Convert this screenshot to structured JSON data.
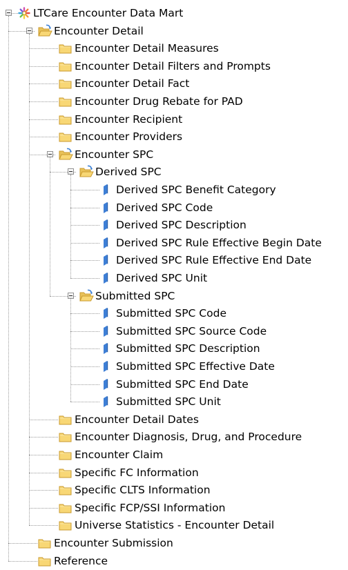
{
  "tree": {
    "root": {
      "label": "LTCare Encounter Data Mart",
      "icon": "universe-icon",
      "expanded": true,
      "children": [
        {
          "label": "Encounter Detail",
          "icon": "folder-open-icon",
          "expanded": true,
          "children": [
            {
              "label": "Encounter Detail Measures",
              "icon": "folder-icon",
              "expanded": false
            },
            {
              "label": "Encounter Detail Filters and Prompts",
              "icon": "folder-icon",
              "expanded": false
            },
            {
              "label": "Encounter Detail Fact",
              "icon": "folder-icon",
              "expanded": false
            },
            {
              "label": "Encounter Drug Rebate for PAD",
              "icon": "folder-icon",
              "expanded": false
            },
            {
              "label": "Encounter Recipient",
              "icon": "folder-icon",
              "expanded": false
            },
            {
              "label": "Encounter Providers",
              "icon": "folder-icon",
              "expanded": false
            },
            {
              "label": "Encounter SPC",
              "icon": "folder-open-icon",
              "expanded": true,
              "children": [
                {
                  "label": "Derived SPC",
                  "icon": "folder-open-icon",
                  "expanded": true,
                  "children": [
                    {
                      "label": "Derived SPC Benefit Category",
                      "icon": "dimension-icon"
                    },
                    {
                      "label": "Derived SPC Code",
                      "icon": "dimension-icon"
                    },
                    {
                      "label": "Derived SPC Description",
                      "icon": "dimension-icon"
                    },
                    {
                      "label": "Derived SPC Rule Effective Begin Date",
                      "icon": "dimension-icon"
                    },
                    {
                      "label": "Derived SPC Rule Effective End Date",
                      "icon": "dimension-icon"
                    },
                    {
                      "label": "Derived SPC Unit",
                      "icon": "dimension-icon"
                    }
                  ]
                },
                {
                  "label": "Submitted SPC",
                  "icon": "folder-open-icon",
                  "expanded": true,
                  "children": [
                    {
                      "label": "Submitted SPC Code",
                      "icon": "dimension-icon"
                    },
                    {
                      "label": "Submitted SPC Source Code",
                      "icon": "dimension-icon"
                    },
                    {
                      "label": "Submitted SPC Description",
                      "icon": "dimension-icon"
                    },
                    {
                      "label": "Submitted SPC Effective Date",
                      "icon": "dimension-icon"
                    },
                    {
                      "label": "Submitted SPC End Date",
                      "icon": "dimension-icon"
                    },
                    {
                      "label": "Submitted SPC Unit",
                      "icon": "dimension-icon"
                    }
                  ]
                }
              ]
            },
            {
              "label": "Encounter Detail Dates",
              "icon": "folder-icon",
              "expanded": false
            },
            {
              "label": "Encounter Diagnosis, Drug, and Procedure",
              "icon": "folder-icon",
              "expanded": false
            },
            {
              "label": "Encounter Claim",
              "icon": "folder-icon",
              "expanded": false
            },
            {
              "label": "Specific FC Information",
              "icon": "folder-icon",
              "expanded": false
            },
            {
              "label": "Specific CLTS Information",
              "icon": "folder-icon",
              "expanded": false
            },
            {
              "label": "Specific FCP/SSI Information",
              "icon": "folder-icon",
              "expanded": false
            },
            {
              "label": "Universe Statistics - Encounter Detail",
              "icon": "folder-icon",
              "expanded": false
            }
          ]
        },
        {
          "label": "Encounter Submission",
          "icon": "folder-icon",
          "expanded": false
        },
        {
          "label": "Reference",
          "icon": "folder-icon",
          "expanded": false
        }
      ]
    }
  },
  "colors": {
    "folder_fill": "#f8d775",
    "folder_edge": "#c99a2e",
    "dimension_blue": "#3e7fd6",
    "connector": "#9a9a9a"
  }
}
